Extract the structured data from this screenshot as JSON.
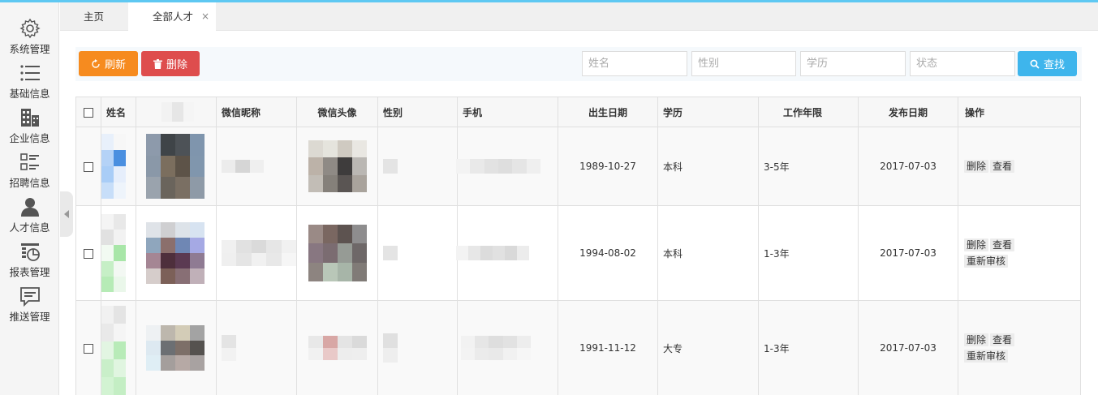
{
  "sidebar": {
    "items": [
      {
        "label": "系统管理",
        "icon": "gear-icon"
      },
      {
        "label": "基础信息",
        "icon": "list-icon"
      },
      {
        "label": "企业信息",
        "icon": "building-icon"
      },
      {
        "label": "招聘信息",
        "icon": "grid-list-icon"
      },
      {
        "label": "人才信息",
        "icon": "user-icon"
      },
      {
        "label": "报表管理",
        "icon": "report-icon"
      },
      {
        "label": "推送管理",
        "icon": "message-icon"
      }
    ]
  },
  "tabs": {
    "home": "主页",
    "active": "全部人才",
    "close": "×"
  },
  "toolbar": {
    "refresh_label": "刷新",
    "delete_label": "删除",
    "search_label": "查找",
    "inputs": {
      "name_placeholder": "姓名",
      "gender_placeholder": "性别",
      "education_placeholder": "学历",
      "status_placeholder": "状态"
    }
  },
  "table": {
    "headers": {
      "name": "姓名",
      "wechat_nick": "微信昵称",
      "wechat_avatar": "微信头像",
      "gender": "性别",
      "phone": "手机",
      "birth": "出生日期",
      "education": "学历",
      "experience": "工作年限",
      "publish": "发布日期",
      "ops": "操作"
    },
    "rows": [
      {
        "birth": "1989-10-27",
        "education": "本科",
        "experience": "3-5年",
        "publish": "2017-07-03",
        "op_delete": "删除",
        "op_view": "查看"
      },
      {
        "birth": "1994-08-02",
        "education": "本科",
        "experience": "1-3年",
        "publish": "2017-07-03",
        "op_delete": "删除",
        "op_view": "查看",
        "op_review": "重新审核"
      },
      {
        "birth": "1991-11-12",
        "education": "大专",
        "experience": "1-3年",
        "publish": "2017-07-03",
        "op_delete": "删除",
        "op_view": "查看",
        "op_review": "重新审核"
      }
    ]
  },
  "colors": {
    "refresh": "#f68b1f",
    "delete": "#de4d4d",
    "search": "#3eb5ec",
    "topline": "#5ec8f2"
  }
}
